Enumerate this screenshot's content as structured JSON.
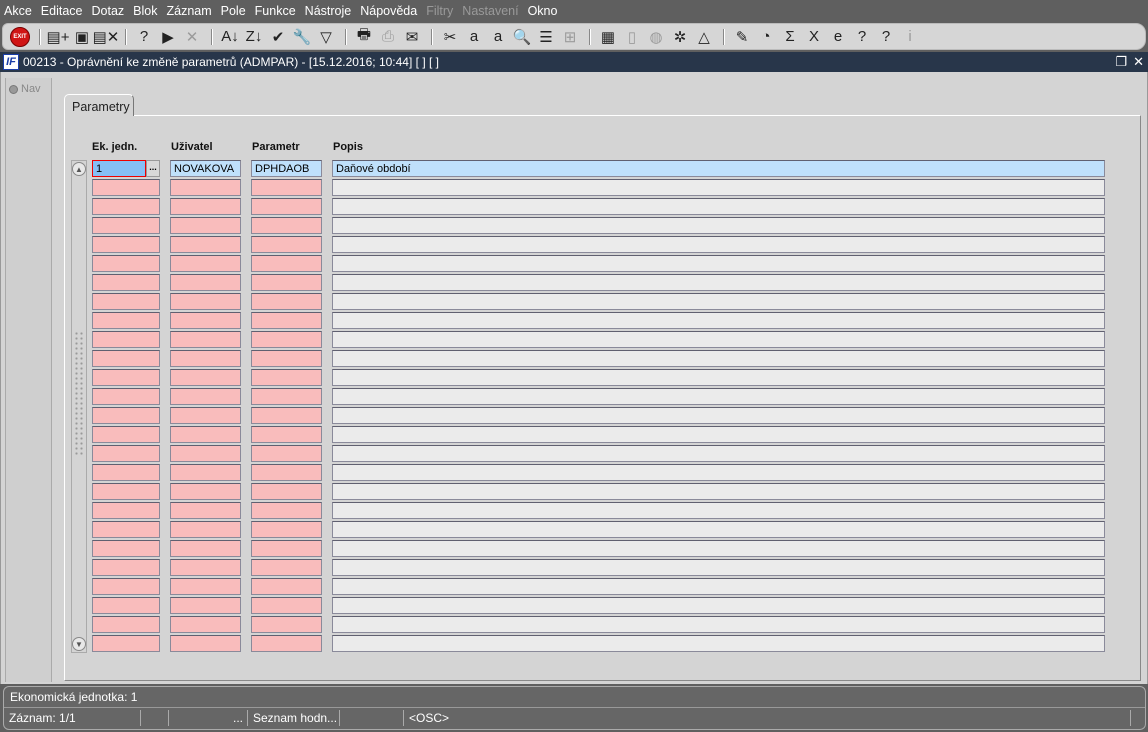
{
  "menu": [
    {
      "label": "Akce",
      "enabled": true
    },
    {
      "label": "Editace",
      "enabled": true
    },
    {
      "label": "Dotaz",
      "enabled": true
    },
    {
      "label": "Blok",
      "enabled": true
    },
    {
      "label": "Záznam",
      "enabled": true
    },
    {
      "label": "Pole",
      "enabled": true
    },
    {
      "label": "Funkce",
      "enabled": true
    },
    {
      "label": "Nástroje",
      "enabled": true
    },
    {
      "label": "Nápověda",
      "enabled": true
    },
    {
      "label": "Filtry",
      "enabled": false
    },
    {
      "label": "Nastavení",
      "enabled": false
    },
    {
      "label": "Okno",
      "enabled": true
    }
  ],
  "toolbar": {
    "exit_label": "EXIT",
    "groups": [
      [
        {
          "name": "insert-record-icon",
          "glyph": "▤+"
        },
        {
          "name": "save-icon",
          "glyph": "▣"
        },
        {
          "name": "delete-record-icon",
          "glyph": "▤✕"
        }
      ],
      [
        {
          "name": "enter-query-icon",
          "glyph": "?"
        },
        {
          "name": "execute-query-icon",
          "glyph": "▶"
        },
        {
          "name": "cancel-query-icon",
          "glyph": "✕",
          "disabled": true
        }
      ],
      [
        {
          "name": "sort-asc-icon",
          "glyph": "A↓"
        },
        {
          "name": "sort-desc-icon",
          "glyph": "Z↓"
        },
        {
          "name": "check-icon",
          "glyph": "✔"
        },
        {
          "name": "wrench-icon",
          "glyph": "🔧",
          "disabled": true
        },
        {
          "name": "filter-icon",
          "glyph": "▽"
        }
      ],
      [
        {
          "name": "print-icon",
          "glyph": "🖶"
        },
        {
          "name": "fax-icon",
          "glyph": "⎙",
          "disabled": true
        },
        {
          "name": "mail-icon",
          "glyph": "✉"
        }
      ],
      [
        {
          "name": "cut-icon",
          "glyph": "✂"
        },
        {
          "name": "copy-icon",
          "glyph": "a"
        },
        {
          "name": "paste-icon",
          "glyph": "a"
        },
        {
          "name": "zoom-icon",
          "glyph": "🔍"
        },
        {
          "name": "list-icon",
          "glyph": "☰"
        },
        {
          "name": "tree-icon",
          "glyph": "⊞",
          "disabled": true
        }
      ],
      [
        {
          "name": "attach-icon",
          "glyph": "▦"
        },
        {
          "name": "document-icon",
          "glyph": "▯",
          "disabled": true
        },
        {
          "name": "globe-icon",
          "glyph": "◍",
          "disabled": true
        },
        {
          "name": "helm-icon",
          "glyph": "✲"
        },
        {
          "name": "eye-icon",
          "glyph": "△"
        }
      ],
      [
        {
          "name": "form-icon",
          "glyph": "✎"
        },
        {
          "name": "gauge-icon",
          "glyph": "◔"
        },
        {
          "name": "sum-icon",
          "glyph": "Σ"
        },
        {
          "name": "excel-icon",
          "glyph": "X"
        },
        {
          "name": "ie-icon",
          "glyph": "e"
        },
        {
          "name": "help-icon",
          "glyph": "?"
        },
        {
          "name": "context-help-icon",
          "glyph": "?"
        },
        {
          "name": "info-icon",
          "glyph": "i",
          "disabled": true
        }
      ]
    ]
  },
  "window": {
    "logo": "IF",
    "title": "00213 - Oprávnění ke změně parametrů (ADMPAR) - [15.12.2016; 10:44]  [ ]  [ ]",
    "restore": "❐",
    "close": "✕"
  },
  "nav": {
    "label": "Nav"
  },
  "tab": {
    "label": "Parametry"
  },
  "table": {
    "columns": [
      "Ek. jedn.",
      "Uživatel",
      "Parametr",
      "Popis"
    ],
    "rows": [
      [
        "1",
        "NOVAKOVA",
        "DPHDAOB",
        "Daňové období"
      ]
    ],
    "visible_rows": 26,
    "lov_label": "..."
  },
  "status": {
    "line1": "Ekonomická jednotka: 1",
    "record": "Záznam: 1/1",
    "ellipsis": "...",
    "lov": "Seznam hodn...",
    "mode": "<OSC>"
  }
}
